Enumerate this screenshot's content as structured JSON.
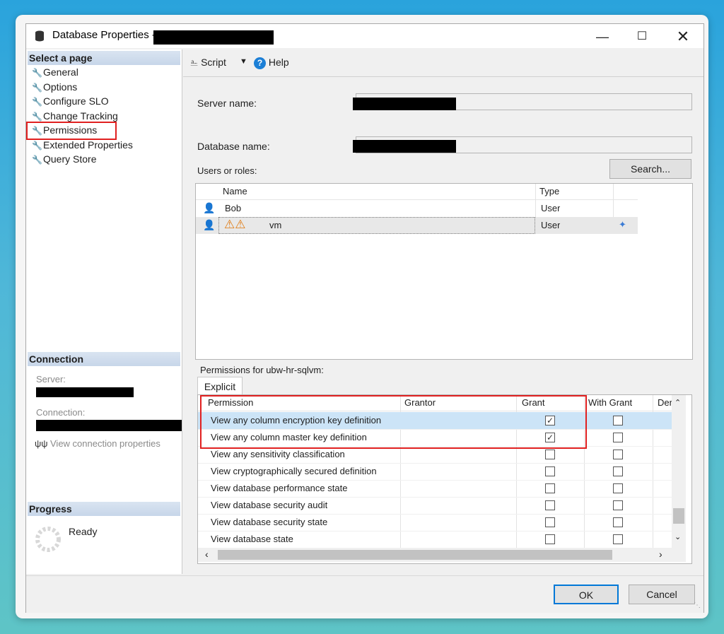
{
  "window": {
    "title": "Database Properties -"
  },
  "left": {
    "select_page_header": "Select a page",
    "pages": [
      {
        "label": "General",
        "icon": "wrench-icon"
      },
      {
        "label": "Options",
        "icon": "wrench-icon"
      },
      {
        "label": "Configure SLO",
        "icon": "wrench-icon"
      },
      {
        "label": "Change Tracking",
        "icon": "wrench-icon"
      },
      {
        "label": "Permissions",
        "icon": "wrench-icon"
      },
      {
        "label": "Extended Properties",
        "icon": "wrench-icon"
      },
      {
        "label": "Query Store",
        "icon": "wrench-icon"
      }
    ],
    "connection_header": "Connection",
    "server_label": "Server:",
    "connection_label": "Connection:",
    "view_connection": "View connection properties",
    "progress_header": "Progress",
    "progress_status": "Ready"
  },
  "toolbar": {
    "script": "Script",
    "help": "Help"
  },
  "main": {
    "server_name_label": "Server name:",
    "database_name_label": "Database name:",
    "users_roles_label": "Users or roles:",
    "search_button": "Search...",
    "users_columns": [
      "Name",
      "Type"
    ],
    "users": [
      {
        "name": "Bob",
        "type": "User"
      },
      {
        "name": "vm",
        "type": "User"
      }
    ],
    "permissions_for": "Permissions for ubw-hr-sqlvm:",
    "tab_explicit": "Explicit",
    "perm_columns": [
      "Permission",
      "Grantor",
      "Grant",
      "With Grant",
      "Der"
    ],
    "permissions": [
      {
        "name": "View any column encryption key definition",
        "grant": true,
        "with_grant": false
      },
      {
        "name": "View any column master key definition",
        "grant": true,
        "with_grant": false
      },
      {
        "name": "View any sensitivity classification",
        "grant": false,
        "with_grant": false
      },
      {
        "name": "View cryptographically secured definition",
        "grant": false,
        "with_grant": false
      },
      {
        "name": "View database performance state",
        "grant": false,
        "with_grant": false
      },
      {
        "name": "View database security audit",
        "grant": false,
        "with_grant": false
      },
      {
        "name": "View database security state",
        "grant": false,
        "with_grant": false
      },
      {
        "name": "View database state",
        "grant": false,
        "with_grant": false
      }
    ]
  },
  "buttons": {
    "ok": "OK",
    "cancel": "Cancel"
  },
  "colors": {
    "highlight_red": "#e02020",
    "selected_row": "#cce4f7",
    "accent_blue": "#0078d7"
  }
}
